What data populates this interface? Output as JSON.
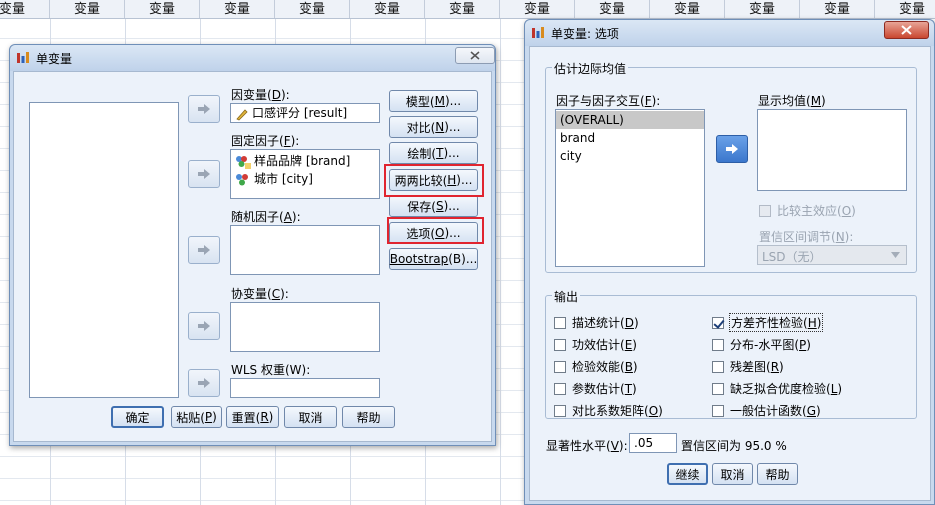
{
  "spreadsheet": {
    "column_label": "变量",
    "columns": [
      "变量",
      "变量",
      "变量",
      "变量",
      "变量",
      "变量",
      "变量",
      "变量",
      "变量",
      "变量",
      "变量",
      "变量",
      "变量"
    ]
  },
  "univariate_dialog": {
    "title": "单变量",
    "dependent_label": "因变量(D):",
    "dependent_label_parts": [
      "因变量(",
      "D",
      "):"
    ],
    "dependent_value": "口感评分 [result]",
    "fixed_label_parts": [
      "固定因子(",
      "F",
      "):"
    ],
    "fixed_items": [
      "样品品牌 [brand]",
      "城市 [city]"
    ],
    "random_label_parts": [
      "随机因子(",
      "A",
      "):"
    ],
    "covariate_label_parts": [
      "协变量(",
      "C",
      "):"
    ],
    "wls_label": "WLS 权重(W):",
    "side_buttons": [
      {
        "pre": "模型(",
        "key": "M",
        "post": ")..."
      },
      {
        "pre": "对比(",
        "key": "N",
        "post": ")..."
      },
      {
        "pre": "绘制(",
        "key": "T",
        "post": ")..."
      },
      {
        "pre": "两两比较(",
        "key": "H",
        "post": ")..."
      },
      {
        "pre": "保存(",
        "key": "S",
        "post": ")..."
      },
      {
        "pre": "选项(",
        "key": "O",
        "post": ")..."
      },
      {
        "pre": "",
        "key": "Bootstrap",
        "post": "(B)..."
      }
    ],
    "bottom_buttons": {
      "ok": "确定",
      "paste": [
        "粘贴(",
        "P",
        ")"
      ],
      "reset": [
        "重置(",
        "R",
        ")"
      ],
      "cancel": "取消",
      "help": "帮助"
    }
  },
  "options_dialog": {
    "title": "单变量: 选项",
    "emm_group": "估计边际均值",
    "factors_label_parts": [
      "因子与因子交互(",
      "F",
      "):"
    ],
    "factors": [
      "(OVERALL)",
      "brand",
      "city"
    ],
    "display_means_label_parts": [
      "显示均值(",
      "M",
      ")"
    ],
    "compare_main_parts": [
      "比较主效应(",
      "O",
      ")"
    ],
    "ci_adjust_parts": [
      "置信区间调节(",
      "N",
      "):"
    ],
    "ci_adjust_value": "LSD（无）",
    "output_group": "输出",
    "output_left": [
      {
        "pre": "描述统计(",
        "key": "D",
        "post": ")",
        "checked": false
      },
      {
        "pre": "功效估计(",
        "key": "E",
        "post": ")",
        "checked": false
      },
      {
        "pre": "检验效能(",
        "key": "B",
        "post": ")",
        "checked": false
      },
      {
        "pre": "参数估计(",
        "key": "T",
        "post": ")",
        "checked": false
      },
      {
        "pre": "对比系数矩阵(",
        "key": "O",
        "post": ")",
        "checked": false
      }
    ],
    "output_right": [
      {
        "pre": "方差齐性检验(",
        "key": "H",
        "post": ")",
        "checked": true
      },
      {
        "pre": "分布-水平图(",
        "key": "P",
        "post": ")",
        "checked": false
      },
      {
        "pre": "残差图(",
        "key": "R",
        "post": ")",
        "checked": false
      },
      {
        "pre": "缺乏拟合优度检验(",
        "key": "L",
        "post": ")",
        "checked": false
      },
      {
        "pre": "一般估计函数(",
        "key": "G",
        "post": ")",
        "checked": false
      }
    ],
    "significance_label_parts": [
      "显著性水平(",
      "V",
      "):"
    ],
    "significance_value": ".05",
    "ci_text": "置信区间为 95.0 %",
    "buttons": {
      "continue": "继续",
      "cancel": "取消",
      "help": "帮助"
    }
  },
  "colors": {
    "highlight": "#e0242f",
    "dialog_bg": "#ecf2fa",
    "selection": "#c8c8c8"
  }
}
